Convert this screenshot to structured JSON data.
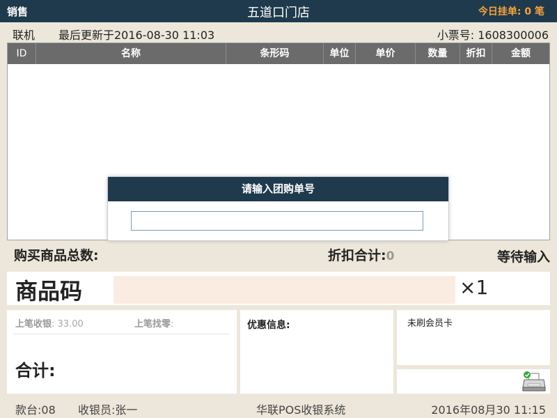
{
  "topbar": {
    "mode": "销售",
    "store_name": "五道口门店",
    "pending_label": "今日挂单",
    "pending_count": "0",
    "pending_unit": "笔"
  },
  "info": {
    "connection": "联机",
    "last_update": "最后更新于2016-08-30 11:03",
    "receipt_label": "小票号",
    "receipt_no": "1608300006"
  },
  "table": {
    "columns": [
      "ID",
      "名称",
      "条形码",
      "单位",
      "单价",
      "数量",
      "折扣",
      "金额"
    ]
  },
  "dialog": {
    "title": "请输入团购单号",
    "value": ""
  },
  "summary": {
    "total_items_label": "购买商品总数:",
    "discount_label": "折扣合计:",
    "discount_value": "0",
    "status": "等待输入"
  },
  "code_entry": {
    "label": "商品码",
    "value": "",
    "multiplier": "×1"
  },
  "payment": {
    "prev_received_label": "上笔收银",
    "prev_received_value": "33.00",
    "prev_change_label": "上笔找零",
    "total_label": "合计:"
  },
  "promo": {
    "title": "优惠信息:"
  },
  "member": {
    "status": "未刷会员卡"
  },
  "printer": {
    "icon": "printer-icon",
    "status_color": "#3aa53a"
  },
  "footer": {
    "terminal": "款台:08",
    "cashier": "收银员:张一",
    "system_name": "华联POS收银系统",
    "datetime": "2016年08月30  11:15"
  },
  "colors": {
    "header_bg": "#1e3a4c",
    "accent": "#f7a23b",
    "table_header": "#6b6b6b",
    "code_input_bg": "#fbece2",
    "page_bg": "#ece7da"
  }
}
